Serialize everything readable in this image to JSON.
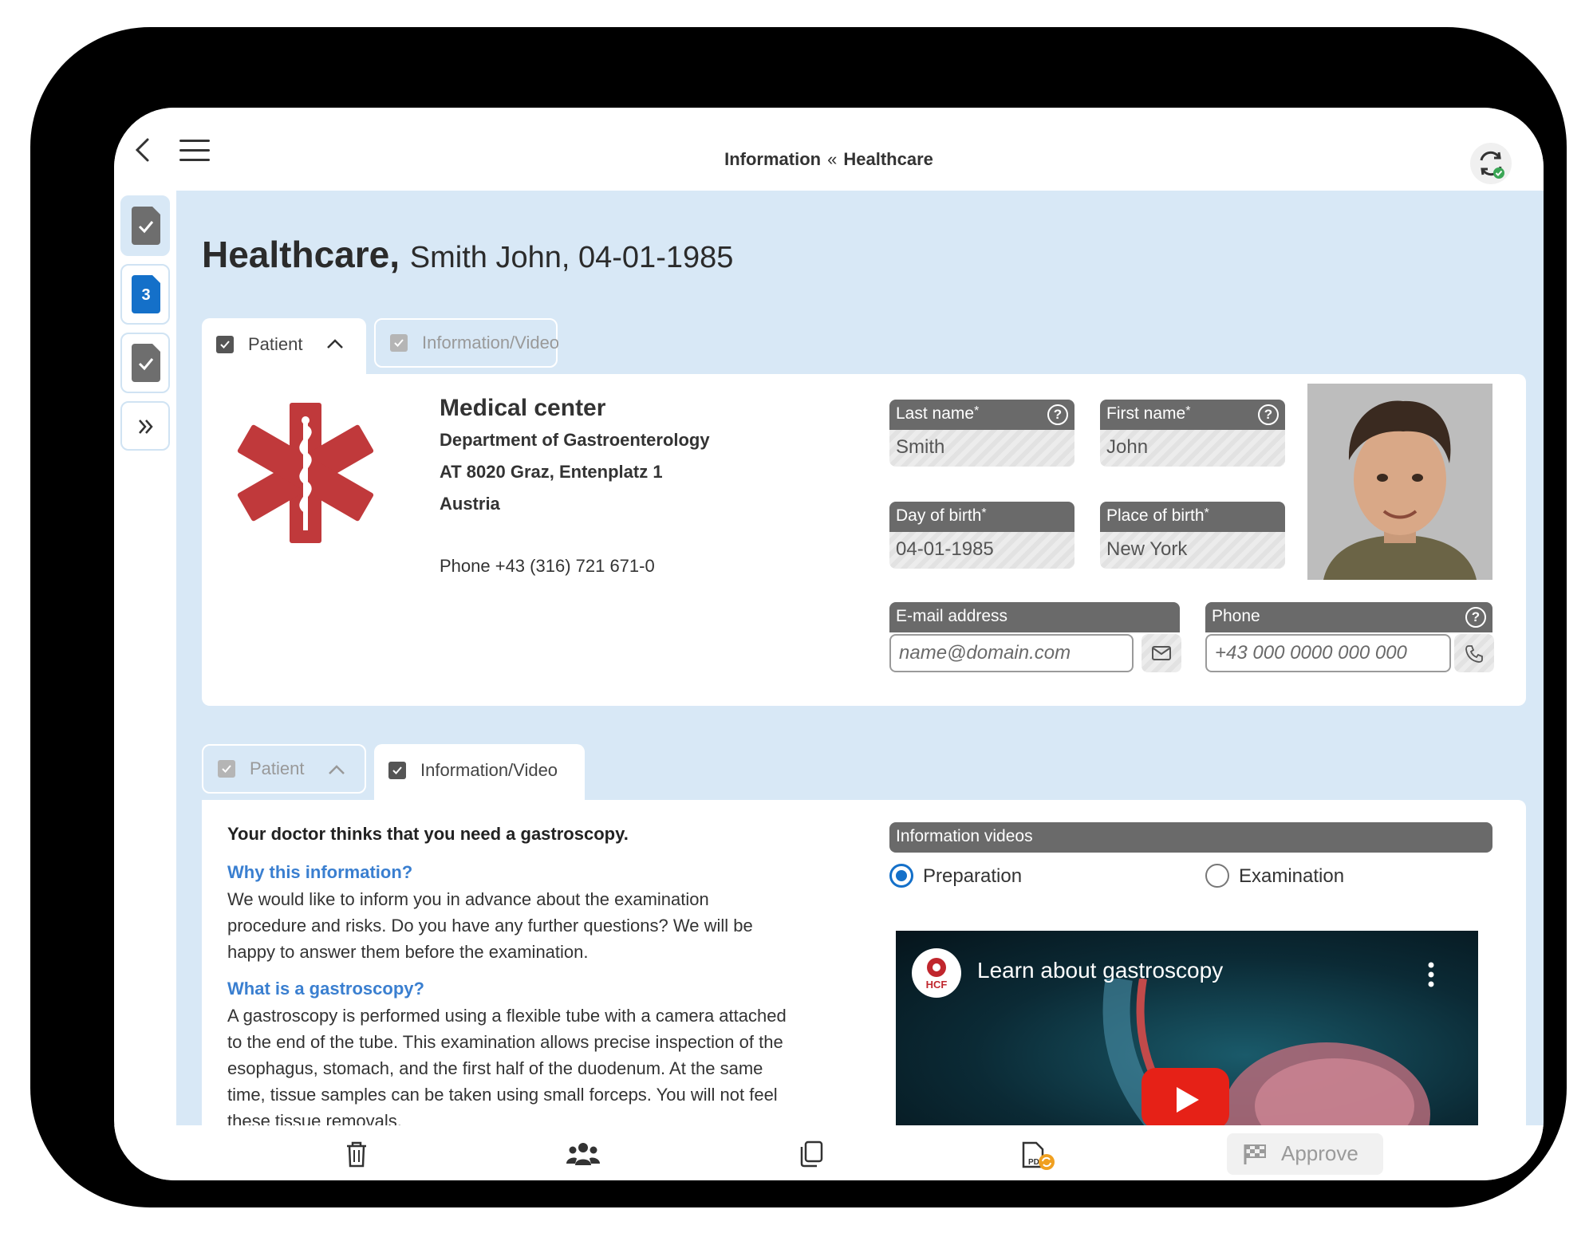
{
  "header": {
    "breadcrumb_left": "Information",
    "breadcrumb_sep": "«",
    "breadcrumb_right": "Healthcare"
  },
  "rail": {
    "badge_count": "3"
  },
  "title": {
    "main": "Healthcare,",
    "sub": "Smith John, 04-01-1985"
  },
  "tabs": {
    "patient": "Patient",
    "info_video": "Information/Video"
  },
  "organization": {
    "name": "Medical center",
    "department": "Department of Gastroenterology",
    "address": "AT 8020 Graz, Entenplatz 1",
    "country": "Austria",
    "phone": "Phone +43 (316) 721 671-0"
  },
  "patient_fields": {
    "last_name_label": "Last name",
    "last_name_value": "Smith",
    "first_name_label": "First name",
    "first_name_value": "John",
    "dob_label": "Day of birth",
    "dob_value": "04-01-1985",
    "pob_label": "Place of birth",
    "pob_value": "New York",
    "email_label": "E-mail address",
    "email_placeholder": "name@domain.com",
    "phone_label": "Phone",
    "phone_placeholder": "+43 000 0000 000 000",
    "required_mark": "*",
    "help_glyph": "?"
  },
  "info": {
    "lead": "Your doctor thinks that you need a gastroscopy.",
    "q1": "Why this information?",
    "a1_l1": "We would like to inform you in advance about the examination",
    "a1_l2": "procedure and risks. Do you have any further questions? We will be",
    "a1_l3": "happy to answer them before the examination.",
    "q2": "What is a gastroscopy?",
    "a2_l1": "A gastroscopy is performed using a flexible tube with a camera attached",
    "a2_l2": "to the end of the tube. This examination allows precise inspection of the",
    "a2_l3": "esophagus, stomach, and the first half of the duodenum. At the same",
    "a2_l4": "time, tissue samples can be taken using small forceps. You will not feel",
    "a2_l5": "these tissue removals."
  },
  "videos": {
    "label": "Information videos",
    "option1": "Preparation",
    "option2": "Examination",
    "selected": "Preparation",
    "video_title": "Learn about gastroscopy",
    "logo_text": "HCF"
  },
  "toolbar": {
    "approve": "Approve"
  },
  "colors": {
    "accent": "#1470c9",
    "content_bg": "#d8e8f6",
    "link": "#3a7fd0",
    "medical_red": "#c0393b"
  }
}
